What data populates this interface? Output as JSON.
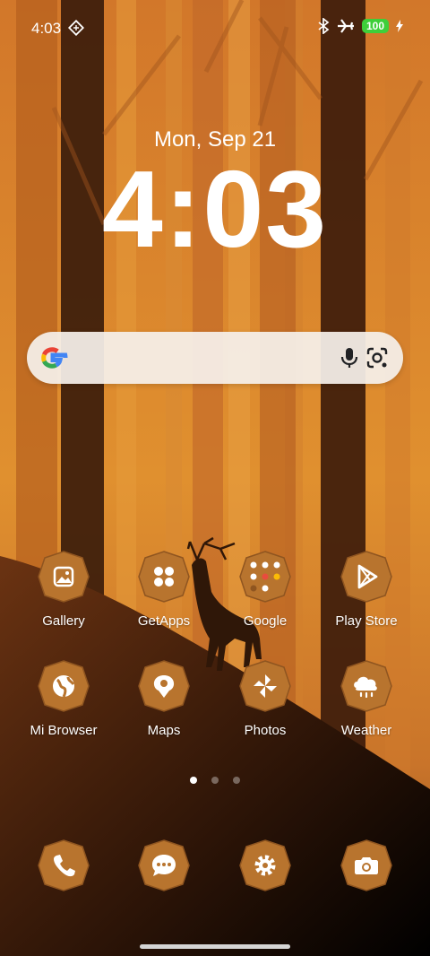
{
  "status": {
    "time": "4:03",
    "battery": "100"
  },
  "lockscreen": {
    "date": "Mon, Sep 21",
    "clock": "4:03"
  },
  "search": {
    "name": "google-search-bar"
  },
  "apps": [
    {
      "label": "Gallery"
    },
    {
      "label": "GetApps"
    },
    {
      "label": "Google"
    },
    {
      "label": "Play Store"
    },
    {
      "label": "Mi Browser"
    },
    {
      "label": "Maps"
    },
    {
      "label": "Photos"
    },
    {
      "label": "Weather"
    }
  ],
  "dock": [
    {
      "icon": "phone-icon"
    },
    {
      "icon": "messages-icon"
    },
    {
      "icon": "settings-icon"
    },
    {
      "icon": "camera-icon"
    }
  ],
  "pages": {
    "count": 3,
    "current": 1
  },
  "colors": {
    "icon_bg": "#b8742e",
    "wallpaper_main": "#d9832e",
    "battery_green": "#3ecf3a"
  }
}
